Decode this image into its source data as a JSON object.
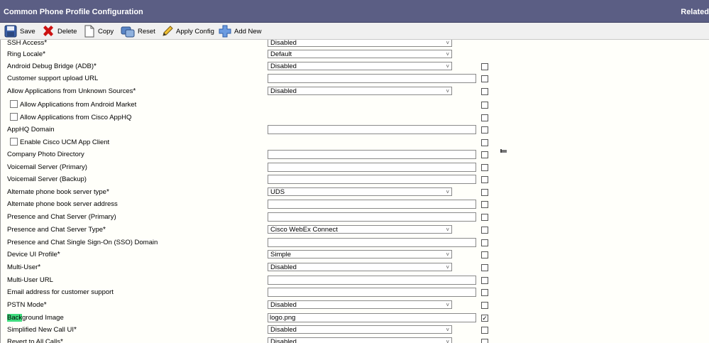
{
  "window": {
    "title": "Common Phone Profile Configuration",
    "related": "Related"
  },
  "toolbar": {
    "save": "Save",
    "delete": "Delete",
    "copy": "Copy",
    "reset": "Reset",
    "apply": "Apply Config",
    "add": "Add New"
  },
  "rows": [
    {
      "label": "SSH Access",
      "req": "*",
      "type": "select",
      "value": "Disabled",
      "override": null
    },
    {
      "label": "Ring Locale",
      "req": "*",
      "type": "select",
      "value": "Default",
      "override": null
    },
    {
      "label": "Android Debug Bridge (ADB)",
      "req": "*",
      "type": "select",
      "value": "Disabled",
      "override": ""
    },
    {
      "label": "Customer support upload URL",
      "req": "",
      "type": "text",
      "value": "",
      "override": ""
    },
    {
      "label": "Allow Applications from Unknown Sources",
      "req": "*",
      "type": "select",
      "value": "Disabled",
      "override": ""
    },
    {
      "label": "Allow Applications from Android Market",
      "req": "",
      "type": "check",
      "value": "",
      "override": ""
    },
    {
      "label": "Allow Applications from Cisco AppHQ",
      "req": "",
      "type": "check",
      "value": "",
      "override": ""
    },
    {
      "label": "AppHQ Domain",
      "req": "",
      "type": "text",
      "value": "",
      "override": ""
    },
    {
      "label": "Enable Cisco UCM App Client",
      "req": "",
      "type": "check",
      "value": "",
      "override": ""
    },
    {
      "label": "Company Photo Directory",
      "req": "",
      "type": "text",
      "value": "",
      "override": ""
    },
    {
      "label": "Voicemail Server (Primary)",
      "req": "",
      "type": "text",
      "value": "",
      "override": ""
    },
    {
      "label": "Voicemail Server (Backup)",
      "req": "",
      "type": "text",
      "value": "",
      "override": ""
    },
    {
      "label": "Alternate phone book server type",
      "req": "*",
      "type": "select",
      "value": "UDS",
      "override": ""
    },
    {
      "label": "Alternate phone book server address",
      "req": "",
      "type": "text",
      "value": "",
      "override": ""
    },
    {
      "label": "Presence and Chat Server (Primary)",
      "req": "",
      "type": "text",
      "value": "",
      "override": ""
    },
    {
      "label": "Presence and Chat Server Type",
      "req": "*",
      "type": "select",
      "value": "Cisco WebEx Connect",
      "override": ""
    },
    {
      "label": "Presence and Chat Single Sign-On (SSO) Domain",
      "req": "",
      "type": "text",
      "value": "",
      "override": ""
    },
    {
      "label": "Device UI Profile",
      "req": "*",
      "type": "select",
      "value": "Simple",
      "override": ""
    },
    {
      "label": "Multi-User",
      "req": "*",
      "type": "select",
      "value": "Disabled",
      "override": ""
    },
    {
      "label": "Multi-User URL",
      "req": "",
      "type": "text",
      "value": "",
      "override": ""
    },
    {
      "label": "Email address for customer support",
      "req": "",
      "type": "text",
      "value": "",
      "override": ""
    },
    {
      "label": "PSTN Mode",
      "req": "*",
      "type": "select",
      "value": "Disabled",
      "override": ""
    },
    {
      "label": "Background Image",
      "req": "",
      "type": "text",
      "value": "logo.png",
      "override": "✓",
      "highlight": "Back"
    },
    {
      "label": "Simplified New Call UI",
      "req": "*",
      "type": "select",
      "value": "Disabled",
      "override": ""
    },
    {
      "label": "Revert to All Calls",
      "req": "*",
      "type": "select",
      "value": "Disabled",
      "override": ""
    }
  ],
  "colors": {
    "titlebar": "#5b5e84",
    "highlight": "#3fdc7e",
    "delete_icon": "#cc1111"
  }
}
